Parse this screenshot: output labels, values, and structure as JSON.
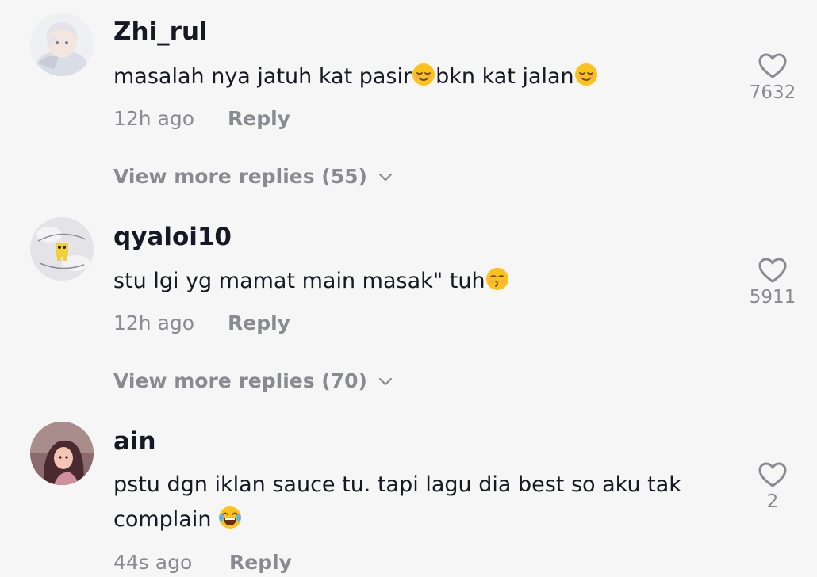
{
  "comments": [
    {
      "username": "Zhi_rul",
      "text_parts": [
        "masalah nya jatuh kat pasir",
        "bkn kat jalan"
      ],
      "emojis": [
        "relieved-face",
        "relieved-face"
      ],
      "time": "12h ago",
      "reply_label": "Reply",
      "likes": "7632",
      "more_replies": "View more replies (55)",
      "avatar_icon": "anime-character-avatar"
    },
    {
      "username": "qyaloi10",
      "text_parts": [
        "stu lgi yg mamat main masak\" tuh"
      ],
      "emojis": [
        "kissing-face"
      ],
      "time": "12h ago",
      "reply_label": "Reply",
      "likes": "5911",
      "more_replies": "View more replies (70)",
      "avatar_icon": "cartoon-character-avatar"
    },
    {
      "username": "ain",
      "text_parts": [
        "pstu dgn iklan sauce tu. tapi lagu dia best so aku tak complain "
      ],
      "emojis": [
        "tears-of-joy-face"
      ],
      "time": "44s ago",
      "reply_label": "Reply",
      "likes": "2",
      "avatar_icon": "anime-girl-avatar"
    }
  ],
  "icons": {
    "like": "heart-outline-icon",
    "expand": "chevron-down-icon"
  },
  "colors": {
    "background": "#f6f6f6",
    "text": "#161823",
    "secondary": "#8a8b91",
    "emoji_yellow": "#fcc21b"
  }
}
